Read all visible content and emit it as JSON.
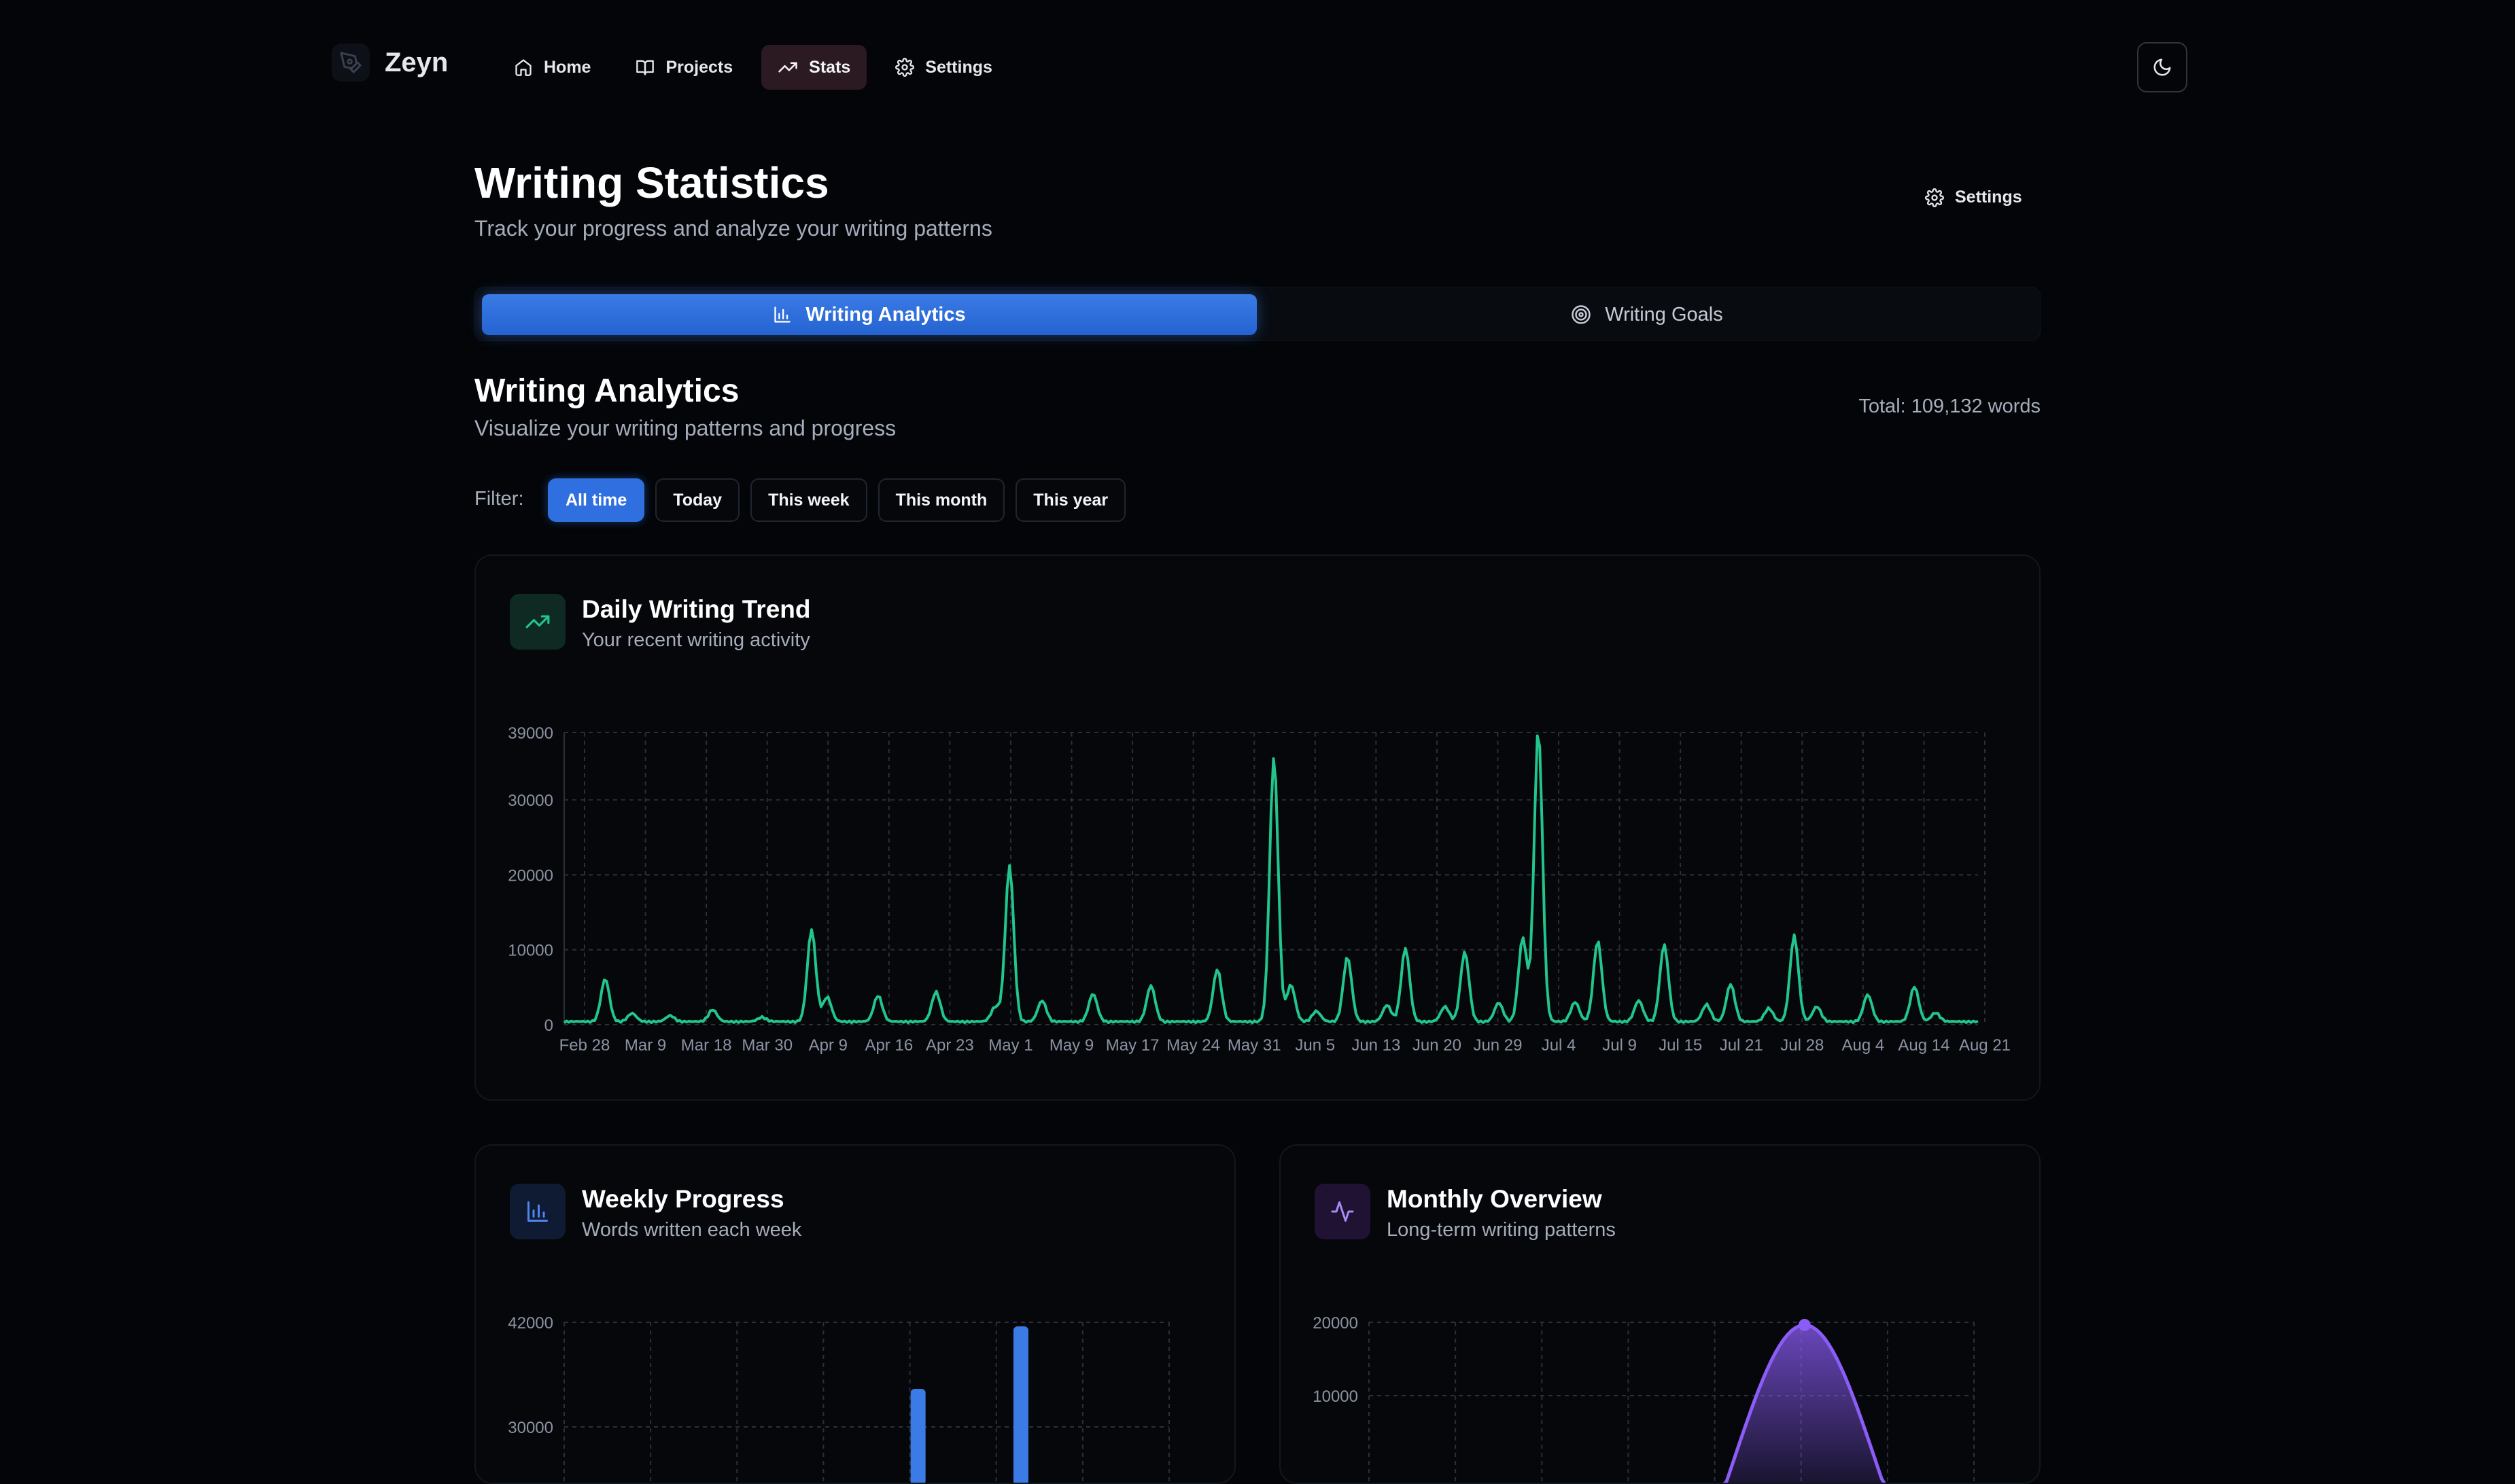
{
  "nav": {
    "brand": "Zeyn",
    "links": [
      {
        "label": "Home",
        "icon": "home-icon"
      },
      {
        "label": "Projects",
        "icon": "book-icon"
      },
      {
        "label": "Stats",
        "icon": "trending-up-icon",
        "active": true
      },
      {
        "label": "Settings",
        "icon": "gear-icon"
      }
    ],
    "theme_toggle_icon": "moon-icon"
  },
  "header": {
    "title": "Writing Statistics",
    "subtitle": "Track your progress and analyze your writing patterns",
    "settings_label": "Settings"
  },
  "tabs": [
    {
      "label": "Writing Analytics",
      "icon": "bar-chart-icon",
      "active": true
    },
    {
      "label": "Writing Goals",
      "icon": "target-icon",
      "active": false
    }
  ],
  "analytics": {
    "title": "Writing Analytics",
    "subtitle": "Visualize your writing patterns and progress",
    "total": "Total: 109,132 words"
  },
  "filter": {
    "label": "Filter:",
    "options": [
      "All time",
      "Today",
      "This week",
      "This month",
      "This year"
    ],
    "selected": "All time"
  },
  "colors": {
    "accent_blue": "#2f6fe0",
    "trend_green": "#22c58b",
    "weekly_blue": "#3b7be6",
    "monthly_purple": "#8b5cf6"
  },
  "cards": {
    "daily": {
      "title": "Daily Writing Trend",
      "subtitle": "Your recent writing activity",
      "icon": "trending-up-icon"
    },
    "weekly": {
      "title": "Weekly Progress",
      "subtitle": "Words written each week",
      "icon": "bar-chart-icon"
    },
    "monthly": {
      "title": "Monthly Overview",
      "subtitle": "Long-term writing patterns",
      "icon": "activity-icon"
    }
  },
  "chart_data": [
    {
      "type": "line",
      "title": "Daily Writing Trend",
      "y_ticks": [
        "0",
        "10000",
        "20000",
        "30000",
        "39000"
      ],
      "ylim": [
        0,
        39000
      ],
      "x_ticks": [
        "Feb 28",
        "Mar 9",
        "Mar 18",
        "Mar 30",
        "Apr 9",
        "Apr 16",
        "Apr 23",
        "May 1",
        "May 9",
        "May 17",
        "May 24",
        "May 31",
        "Jun 5",
        "Jun 13",
        "Jun 20",
        "Jun 29",
        "Jul 4",
        "Jul 9",
        "Jul 15",
        "Jul 21",
        "Jul 28",
        "Aug 4",
        "Aug 14",
        "Aug 21"
      ],
      "grid": true,
      "peaks": [
        {
          "x": 0.029,
          "y": 5700
        },
        {
          "x": 0.048,
          "y": 1100
        },
        {
          "x": 0.075,
          "y": 800
        },
        {
          "x": 0.105,
          "y": 1600
        },
        {
          "x": 0.14,
          "y": 600
        },
        {
          "x": 0.175,
          "y": 12300
        },
        {
          "x": 0.186,
          "y": 3300
        },
        {
          "x": 0.222,
          "y": 3500
        },
        {
          "x": 0.263,
          "y": 4000
        },
        {
          "x": 0.305,
          "y": 2000
        },
        {
          "x": 0.315,
          "y": 20800
        },
        {
          "x": 0.338,
          "y": 2800
        },
        {
          "x": 0.374,
          "y": 3700
        },
        {
          "x": 0.415,
          "y": 4800
        },
        {
          "x": 0.462,
          "y": 7000
        },
        {
          "x": 0.502,
          "y": 35400
        },
        {
          "x": 0.514,
          "y": 4900
        },
        {
          "x": 0.532,
          "y": 1400
        },
        {
          "x": 0.554,
          "y": 8600
        },
        {
          "x": 0.582,
          "y": 2200
        },
        {
          "x": 0.595,
          "y": 9800
        },
        {
          "x": 0.623,
          "y": 2000
        },
        {
          "x": 0.637,
          "y": 9300
        },
        {
          "x": 0.661,
          "y": 2500
        },
        {
          "x": 0.678,
          "y": 11200
        },
        {
          "x": 0.689,
          "y": 39000
        },
        {
          "x": 0.715,
          "y": 2600
        },
        {
          "x": 0.731,
          "y": 10800
        },
        {
          "x": 0.76,
          "y": 2800
        },
        {
          "x": 0.778,
          "y": 10300
        },
        {
          "x": 0.808,
          "y": 2300
        },
        {
          "x": 0.825,
          "y": 5000
        },
        {
          "x": 0.852,
          "y": 1800
        },
        {
          "x": 0.87,
          "y": 11500
        },
        {
          "x": 0.886,
          "y": 2000
        },
        {
          "x": 0.922,
          "y": 3600
        },
        {
          "x": 0.955,
          "y": 4700
        },
        {
          "x": 0.97,
          "y": 1200
        }
      ]
    },
    {
      "type": "bar",
      "title": "Weekly Progress",
      "y_ticks": [
        "42000",
        "30000"
      ],
      "values_visible": [
        {
          "x": 0.585,
          "y": 30500
        },
        {
          "x": 0.755,
          "y": 41500
        }
      ]
    },
    {
      "type": "area",
      "title": "Monthly Overview",
      "y_ticks": [
        "20000",
        "10000"
      ],
      "curve": {
        "peak_x": 0.72,
        "peak_y": 20000
      }
    }
  ]
}
